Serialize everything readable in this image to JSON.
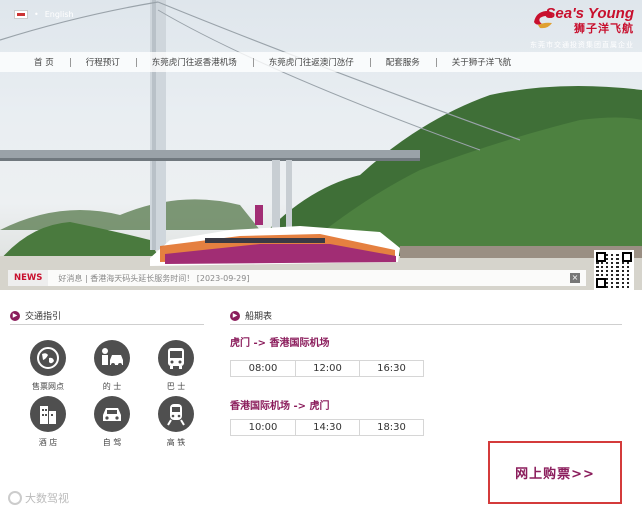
{
  "header": {
    "lang_other": "English",
    "logo_en": "Sea's Young",
    "logo_cn": "狮子洋飞航",
    "logo_sub": "东莞市交通投资集团直属企业"
  },
  "nav": {
    "items": [
      "首 页",
      "行程预订",
      "东莞虎门往返香港机场",
      "东莞虎门往返澳门氹仔",
      "配套服务",
      "关于狮子洋飞航"
    ]
  },
  "news": {
    "tag": "NEWS",
    "text": "好消息 | 香港海天码头延长服务时间！  [2023-09-29]"
  },
  "transport": {
    "title": "交通指引",
    "items": [
      "售票网点",
      "的 士",
      "巴 士",
      "酒 店",
      "自 驾",
      "高 铁"
    ]
  },
  "schedule": {
    "title": "船期表",
    "routes": [
      {
        "title": "虎门 -> 香港国际机场",
        "times": [
          "08:00",
          "12:00",
          "16:30"
        ]
      },
      {
        "title": "香港国际机场  -> 虎门",
        "times": [
          "10:00",
          "14:30",
          "18:30"
        ]
      }
    ]
  },
  "buy": {
    "label": "网上购票>>"
  },
  "watermark": {
    "text": "大数驾视"
  },
  "colors": {
    "brand": "#8b1d5c",
    "accent_red": "#c8102e",
    "buy_border": "#d43b3b"
  }
}
